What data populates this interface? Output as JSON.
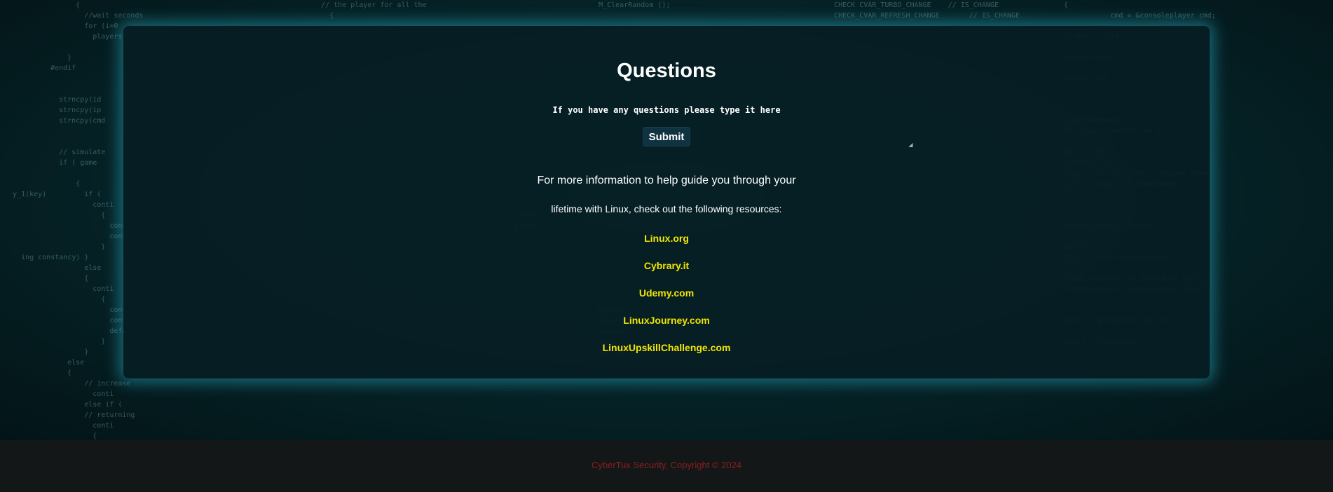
{
  "modal": {
    "title": "Questions",
    "question_placeholder": "If you have any questions please type it here",
    "submit_label": "Submit",
    "info_line1": "For more information to help guide you through your",
    "info_line2": "lifetime with Linux, check out the following resources:",
    "resources": [
      "Linux.org",
      "Cybrary.it",
      "Udemy.com",
      "LinuxJourney.com",
      "LinuxUpskillChallenge.com"
    ]
  },
  "footer": {
    "copyright": "CyberTux Security, Copyright © 2024"
  },
  "colors": {
    "link": "#f2e600",
    "copyright": "#8a1f1f",
    "modal_glow": "#28aabe",
    "footer_bg": "#141718"
  }
}
